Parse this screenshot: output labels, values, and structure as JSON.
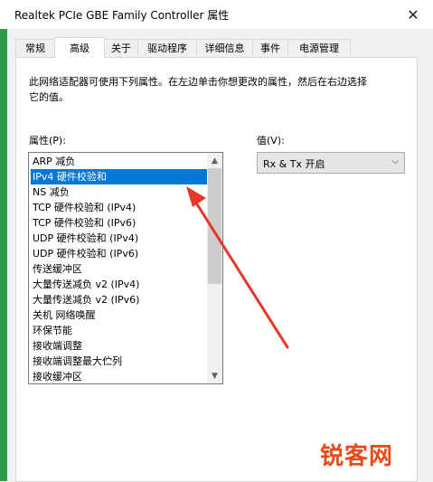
{
  "window": {
    "title": "Realtek PCIe GBE Family Controller 属性"
  },
  "tabs": [
    {
      "label": "常规"
    },
    {
      "label": "高级"
    },
    {
      "label": "关于"
    },
    {
      "label": "驱动程序"
    },
    {
      "label": "详细信息"
    },
    {
      "label": "事件"
    },
    {
      "label": "电源管理"
    }
  ],
  "active_tab": "高级",
  "advanced": {
    "description": "此网络适配器可使用下列属性。在左边单击你想更改的属性，然后在右边选择它的值。",
    "property_label": "属性(P):",
    "value_label": "值(V):",
    "properties": [
      "ARP 减负",
      "IPv4 硬件校验和",
      "NS 减负",
      "TCP 硬件校验和 (IPv4)",
      "TCP 硬件校验和 (IPv6)",
      "UDP 硬件校验和 (IPv4)",
      "UDP 硬件校验和 (IPv6)",
      "传送缓冲区",
      "大量传送减负 v2 (IPv4)",
      "大量传送减负 v2 (IPv6)",
      "关机 网络唤醒",
      "环保节能",
      "接收端调整",
      "接收端调整最大伫列",
      "接收缓冲区"
    ],
    "selected_property": "IPv4 硬件校验和",
    "value": "Rx & Tx 开启"
  },
  "watermark": {
    "text": "锐客网",
    "color": "#e84b1a"
  },
  "colors": {
    "selection": "#0078d7",
    "annotation_arrow": "#e8362a",
    "side_strip": "#2e9a4a"
  },
  "icons": {
    "close": "close-icon",
    "scroll_up": "chevron-up-icon",
    "scroll_down": "chevron-down-icon",
    "dropdown": "chevron-down-icon"
  }
}
